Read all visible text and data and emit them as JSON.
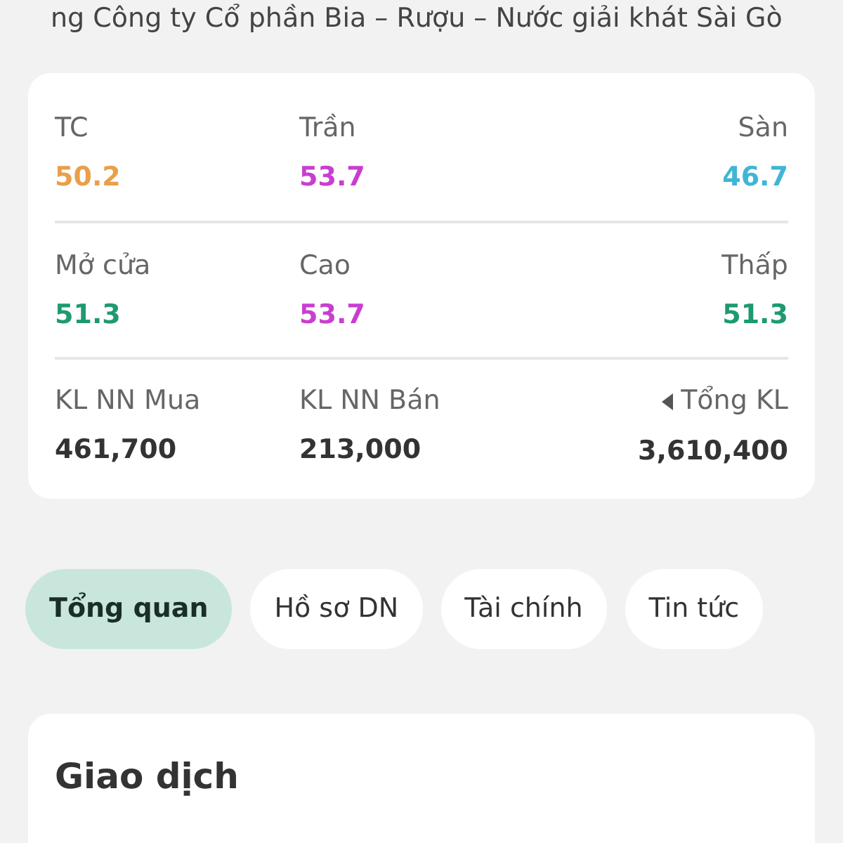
{
  "header": {
    "title": "ng Công ty Cổ phần Bia – Rượu – Nước giải khát Sài Gò"
  },
  "stats": [
    [
      {
        "label": "TC",
        "value": "50.2",
        "color": "#e8a04a",
        "kind": "plain"
      },
      {
        "label": "Trần",
        "value": "53.7",
        "color": "#c83fd0",
        "kind": "plain"
      },
      {
        "label": "Sàn",
        "value": "46.7",
        "color": "#3fb6d6",
        "kind": "plain"
      }
    ],
    [
      {
        "label": "Mở cửa",
        "value": "51.3",
        "color": "#1e9b6e",
        "kind": "plain"
      },
      {
        "label": "Cao",
        "value": "53.7",
        "color": "#c83fd0",
        "kind": "plain"
      },
      {
        "label": "Thấp",
        "value": "51.3",
        "color": "#1e9b6e",
        "kind": "plain"
      }
    ],
    [
      {
        "label": "KL NN Mua",
        "value": "461,700",
        "color": "#333333",
        "kind": "plain"
      },
      {
        "label": "KL NN Bán",
        "value": "213,000",
        "color": "#333333",
        "kind": "plain"
      },
      {
        "label": "Tổng KL",
        "value": "3,610,400",
        "color": "#333333",
        "kind": "toggle"
      }
    ]
  ],
  "tabs": [
    {
      "label": "Tổng quan",
      "selected": true
    },
    {
      "label": "Hồ sơ DN",
      "selected": false
    },
    {
      "label": "Tài chính",
      "selected": false
    },
    {
      "label": "Tin tức",
      "selected": false
    }
  ],
  "section": {
    "title": "Giao dịch"
  }
}
